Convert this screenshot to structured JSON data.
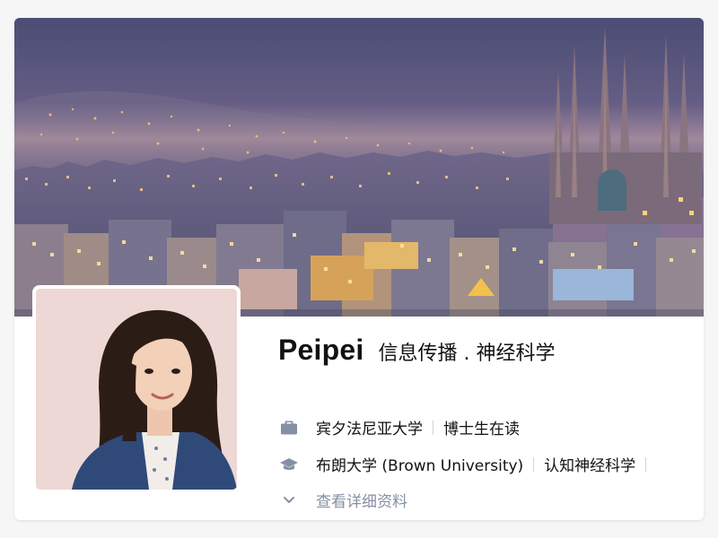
{
  "profile": {
    "name": "Peipei",
    "headline": "信息传播 . 神经科学",
    "employment": {
      "icon": "briefcase-icon",
      "company": "宾夕法尼亚大学",
      "position": "博士生在读"
    },
    "education": {
      "icon": "graduation-cap-icon",
      "school": "布朗大学 (Brown University)",
      "major": "认知神经科学"
    },
    "more": {
      "icon": "chevron-down-icon",
      "label": "查看详细资料"
    }
  },
  "colors": {
    "text_primary": "#121212",
    "text_secondary": "#8590a6",
    "separator": "#d3d3d3",
    "card_bg": "#ffffff",
    "page_bg": "#f6f6f6"
  }
}
